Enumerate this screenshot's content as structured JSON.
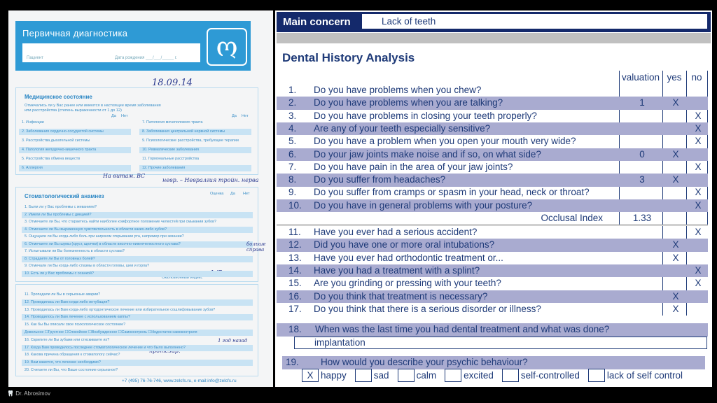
{
  "form": {
    "title": "Первичная диагностика",
    "patient_label": "Пациент",
    "dob_label": "Дата рождения ___/___/_____ г.",
    "date_handwritten": "18.09.14",
    "medical": {
      "title": "Медицинское состояние",
      "subtitle1": "Отмечались ли у Вас ранее или имеются в настоящее время заболевания",
      "subtitle2": "или расстройства (степень выраженности от 1 до 12)",
      "yes": "Да",
      "no": "Нет",
      "left": [
        "1. Инфекции",
        "2. Заболевания сердечно-сосудистой системы",
        "3. Расстройства дыхательной системы",
        "4. Патология желудочно-кишечного тракта",
        "5. Расстройства обмена веществ",
        "6. Аллергия"
      ],
      "right": [
        "7. Патология мочеполового тракта",
        "8. Заболевания центральной нервной системы",
        "9. Психологические расстройства, требующие терапии",
        "10. Ревматические заболевания",
        "11. Гормональные расстройства",
        "12. Прочие заболевания"
      ],
      "notes": [
        "На витам. ВС",
        "невр. – Невралгия тройн. нерва"
      ]
    },
    "anamnesis": {
      "title": "Стоматологический анамнез",
      "col_score": "Оценка",
      "col_yes": "Да",
      "col_no": "Нет",
      "items": [
        "1. Были ли у Вас проблемы с жеванием?",
        "2. Имели ли Вы проблемы с дикцией?",
        "3. Отмечаете ли Вы, что стараетесь найти наиболее комфортное положение челюстей при смыкании зубов?",
        "4. Отмечаете ли Вы выраженную чувствительность в области каких-либо зубов?",
        "5. Ощущали ли Вы когда-либо боль при широком открывании рта, например при зевании?",
        "6. Отмечаете ли Вы шумы (хруст, щелчки) в области височно-нижнечелюстного сустава?",
        "7. Испытывали ли Вы болезненность в области сустава?",
        "8. Страдаете ли Вы от головных болей?",
        "9. Отмечали ли Вы когда-либо спазмы в области головы, шеи и горла?",
        "10. Есть ли у Вас проблемы с осанкой?"
      ],
      "index_label": "Окклюзионный индекс",
      "index_hand": "1/2",
      "side_note": "больше справа"
    },
    "anamnesis2": {
      "items": [
        "11. Пропадали ли Вы в серьезные аварии?",
        "12. Проводилась ли Вам когда-либо интубация?",
        "13. Проводилась ли Вам когда-либо ортодонтическое лечение или избирательное сошлифовывание зубов?",
        "14. Проводилось ли Вам лечение с использованием каппы?",
        "15. Как бы Вы описали свое психологическое состояние?",
        "Довольное  ☐Грустное  ☐Спокойное  ☐Возбужденное  ☐Самоконтроль  ☐Недостаток самоконтроля",
        "16. Скрипите ли Вы зубами или стискиваете их?",
        "17. Когда Вам проводилось последнее стоматологическое лечение и что было выполнено?",
        "18. Какова причина обращения к стоматологу сейчас?",
        "19. Вам кажется, что лечение необходимо?",
        "20. Считаете ли Вы, что Ваше состояние серьезное?"
      ],
      "hand_reason": "протезир.",
      "hand_last": "1 год назад имп."
    },
    "footer": "+7 (495) 76-76-746, www.zelcfs.ru, e-mail:info@zelcfs.ru"
  },
  "watermark": "Dr. Abrosimov",
  "main_concern": {
    "label": "Main concern",
    "value": "Lack of teeth"
  },
  "analysis": {
    "title": "Dental History Analysis",
    "headers": {
      "valuation": "valuation",
      "yes": "yes",
      "no": "no"
    },
    "rows": [
      {
        "n": "1.",
        "q": "Do you have problems when you chew?",
        "v": "",
        "yes": "",
        "no": ""
      },
      {
        "n": "2.",
        "q": "Do you have problems when you are talking?",
        "v": "1",
        "yes": "X",
        "no": ""
      },
      {
        "n": "3.",
        "q": "Do you have problems in closing your teeth properly?",
        "v": "",
        "yes": "",
        "no": "X"
      },
      {
        "n": "4.",
        "q": "Are any of your teeth especially sensitive?",
        "v": "",
        "yes": "",
        "no": "X"
      },
      {
        "n": "5.",
        "q": "Do you have a problem when you open your mouth very wide?",
        "v": "",
        "yes": "",
        "no": "X"
      },
      {
        "n": "6.",
        "q": "Do your jaw joints make noise and if so, on what side?",
        "v": "0",
        "yes": "X",
        "no": ""
      },
      {
        "n": "7.",
        "q": "Do you have pain in the area of your jaw joints?",
        "v": "",
        "yes": "",
        "no": "X"
      },
      {
        "n": "8.",
        "q": "Do you suffer from headaches?",
        "v": "3",
        "yes": "X",
        "no": ""
      },
      {
        "n": "9.",
        "q": "Do you suffer from cramps or spasm in your head, neck or throat?",
        "v": "",
        "yes": "",
        "no": "X"
      },
      {
        "n": "10.",
        "q": "Do you have in general problems with your posture?",
        "v": "",
        "yes": "",
        "no": "X"
      }
    ],
    "occlusal_label": "Occlusal Index",
    "occlusal_value": "1.33",
    "rows2": [
      {
        "n": "11.",
        "q": "Have you ever had a serious accident?",
        "yes": "",
        "no": "X"
      },
      {
        "n": "12.",
        "q": "Did you have one or more oral intubations?",
        "yes": "X",
        "no": ""
      },
      {
        "n": "13.",
        "q": "Have you ever had orthodontic treatment or...",
        "yes": "X",
        "no": ""
      },
      {
        "n": "14.",
        "q": "Have you had a treatment with a splint?",
        "yes": "",
        "no": "X"
      },
      {
        "n": "15.",
        "q": "Are you grinding or pressing with your teeth?",
        "yes": "",
        "no": "X"
      },
      {
        "n": "16.",
        "q": "Do you think that treatment is necessary?",
        "yes": "X",
        "no": ""
      },
      {
        "n": "17.",
        "q": "Do you think that there is a serious disorder or illness?",
        "yes": "X",
        "no": ""
      }
    ],
    "q18": {
      "n": "18.",
      "q": "When was the last time you had dental treatment and what was done?",
      "answer": "implantation"
    },
    "q19": {
      "n": "19.",
      "q": "How would you describe your psychic behaviour?",
      "options": [
        {
          "label": "happy",
          "checked": true
        },
        {
          "label": "sad",
          "checked": false
        },
        {
          "label": "calm",
          "checked": false
        },
        {
          "label": "excited",
          "checked": false
        },
        {
          "label": "self-controlled",
          "checked": false
        },
        {
          "label": "lack of self control",
          "checked": false
        }
      ]
    }
  },
  "colors": {
    "navy": "#14296b",
    "lavender": "#a9abd0",
    "text": "#1e3a78",
    "form_blue": "#2e9ad5"
  }
}
